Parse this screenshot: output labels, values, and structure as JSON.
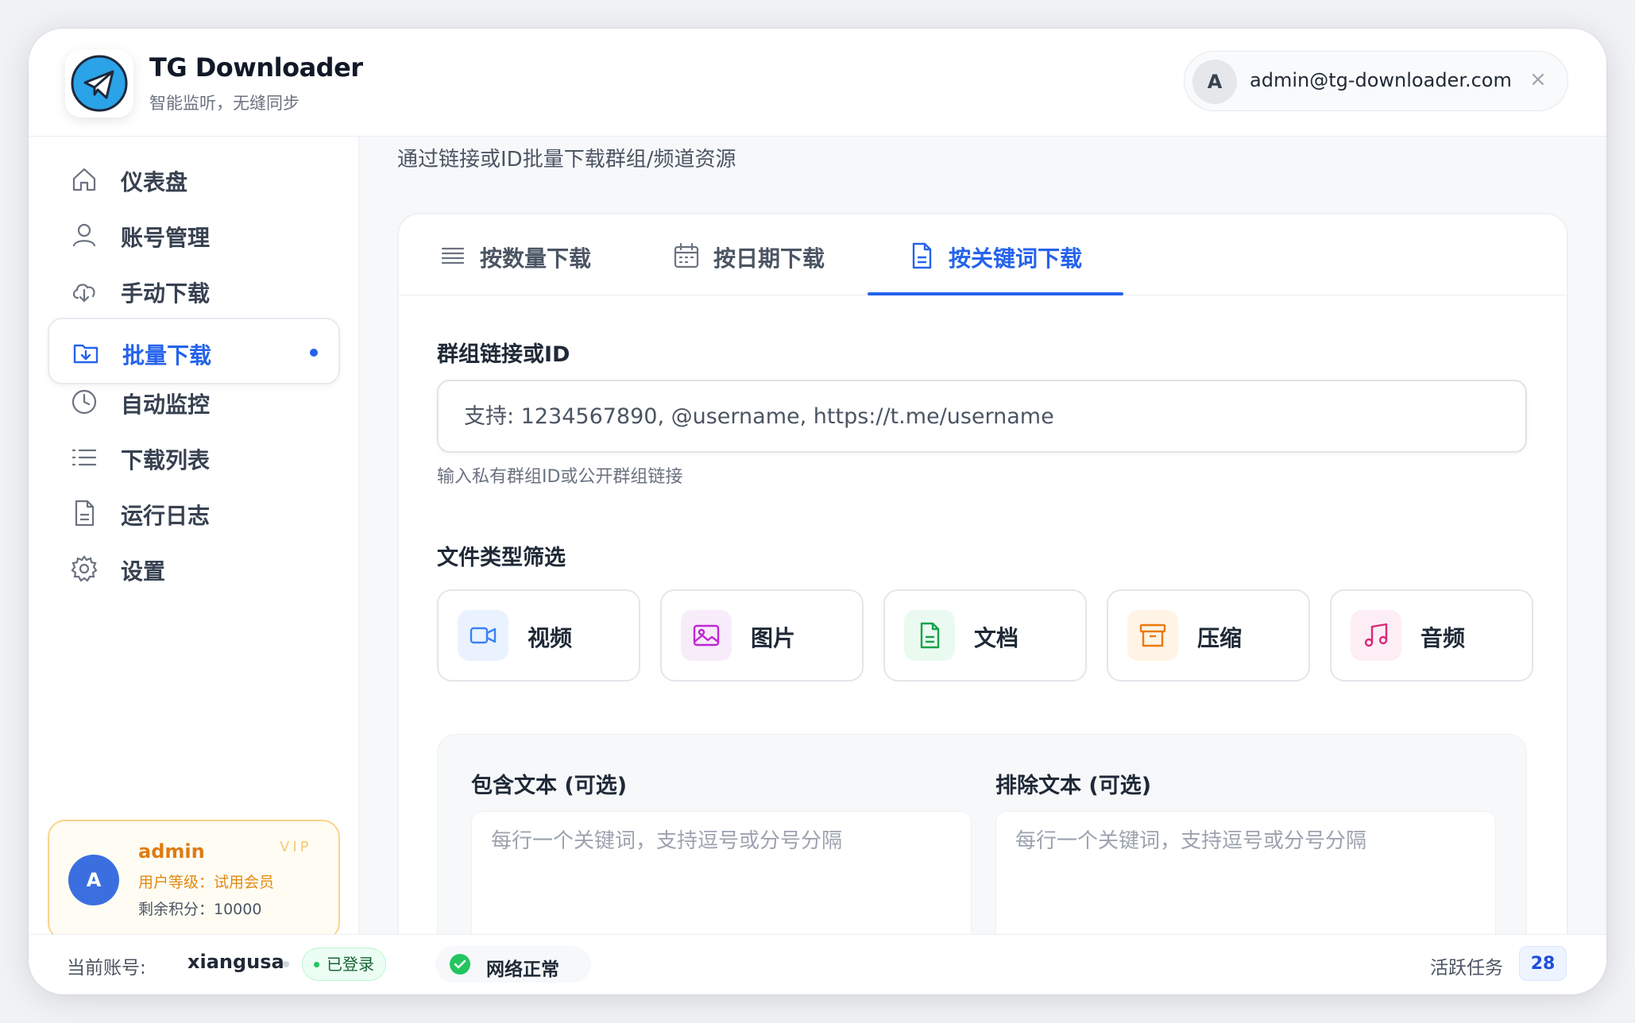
{
  "app": {
    "title": "TG Downloader",
    "subtitle": "智能监听，无缝同步",
    "brand_color": "#2aa3e8"
  },
  "header": {
    "user_avatar": "A",
    "user_email": "admin@tg-downloader.com",
    "close_label": "×"
  },
  "sidebar": {
    "items": [
      {
        "label": "仪表盘",
        "icon": "home-icon"
      },
      {
        "label": "账号管理",
        "icon": "user-icon"
      },
      {
        "label": "手动下载",
        "icon": "cloud-download-icon"
      },
      {
        "label": "批量下载",
        "icon": "folder-download-icon",
        "active": true
      },
      {
        "label": "自动监控",
        "icon": "clock-icon"
      },
      {
        "label": "下载列表",
        "icon": "list-icon"
      },
      {
        "label": "运行日志",
        "icon": "file-text-icon"
      },
      {
        "label": "设置",
        "icon": "gear-icon"
      }
    ],
    "vip": {
      "avatar": "A",
      "name": "admin",
      "tag": "VIP",
      "level": "用户等级：试用会员",
      "points": "剩余积分：10000"
    }
  },
  "main": {
    "description": "通过链接或ID批量下载群组/频道资源",
    "tabs": [
      {
        "label": "按数量下载",
        "icon": "list-lines-icon"
      },
      {
        "label": "按日期下载",
        "icon": "calendar-icon"
      },
      {
        "label": "按关键词下载",
        "icon": "document-icon",
        "active": true
      }
    ],
    "group_field": {
      "label": "群组链接或ID",
      "placeholder": "支持: 1234567890, @username, https://t.me/username",
      "value": "",
      "hint": "输入私有群组ID或公开群组链接"
    },
    "file_filter": {
      "label": "文件类型筛选",
      "types": [
        {
          "label": "视频",
          "icon": "video-icon",
          "color": "#3b82f6",
          "bg": "#eaf2ff"
        },
        {
          "label": "图片",
          "icon": "image-icon",
          "color": "#c026d3",
          "bg": "#f8ecfb"
        },
        {
          "label": "文档",
          "icon": "document-icon",
          "color": "#16a34a",
          "bg": "#eafaf0"
        },
        {
          "label": "压缩",
          "icon": "archive-icon",
          "color": "#ea7a0c",
          "bg": "#fff4e6"
        },
        {
          "label": "音频",
          "icon": "music-icon",
          "color": "#db2777",
          "bg": "#fdeef5"
        }
      ]
    },
    "include_text": {
      "label": "包含文本 (可选)",
      "placeholder": "每行一个关键词，支持逗号或分号分隔"
    },
    "exclude_text": {
      "label": "排除文本 (可选)",
      "placeholder": "每行一个关键词，支持逗号或分号分隔"
    }
  },
  "footer": {
    "account_label": "当前账号:",
    "account_name": "xiangusa",
    "login_status": "已登录",
    "network_status": "网络正常",
    "active_tasks_label": "活跃任务",
    "active_tasks_count": "28"
  },
  "colors": {
    "accent": "#2563eb",
    "vip": "#e07b12",
    "success": "#22c55e"
  }
}
